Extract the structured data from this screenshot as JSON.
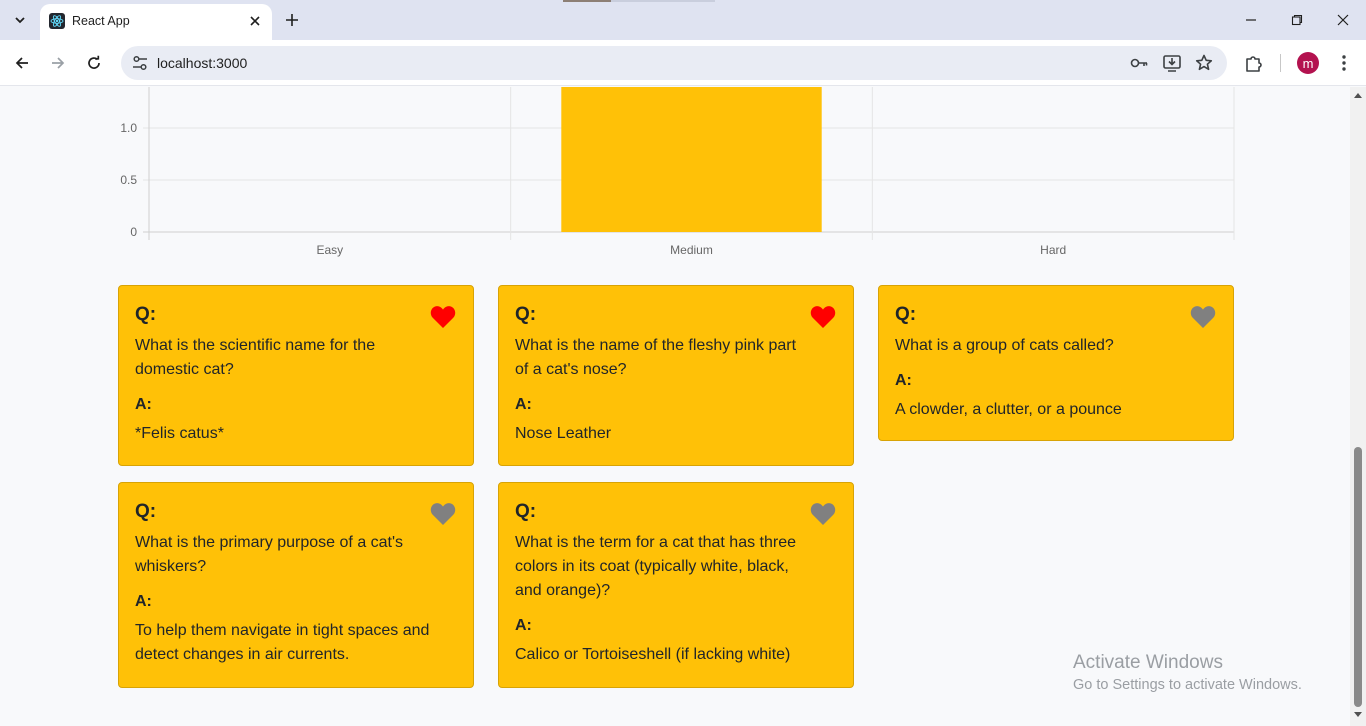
{
  "browser": {
    "tab": {
      "title": "React App"
    },
    "omnibox": {
      "url": "localhost:3000"
    },
    "profile_initial": "m"
  },
  "chart_data": {
    "type": "bar",
    "categories": [
      "Easy",
      "Medium",
      "Hard"
    ],
    "values": [
      0,
      2,
      0
    ],
    "yticks": [
      "0",
      "0.5",
      "1.0"
    ],
    "title": "",
    "xlabel": "",
    "ylabel": "",
    "ylim": [
      0,
      1.4
    ],
    "bar_color": "#ffc107",
    "grid": true
  },
  "cards": [
    {
      "q_label": "Q:",
      "question": "What is the scientific name for the domestic cat?",
      "a_label": "A:",
      "answer": "*Felis catus*",
      "favorite": true
    },
    {
      "q_label": "Q:",
      "question": "What is the name of the fleshy pink part of a cat's nose?",
      "a_label": "A:",
      "answer": "Nose Leather",
      "favorite": true
    },
    {
      "q_label": "Q:",
      "question": "What is a group of cats called?",
      "a_label": "A:",
      "answer": "A clowder, a clutter, or a pounce",
      "favorite": false
    },
    {
      "q_label": "Q:",
      "question": "What is the primary purpose of a cat's whiskers?",
      "a_label": "A:",
      "answer": "To help them navigate in tight spaces and detect changes in air currents.",
      "favorite": false
    },
    {
      "q_label": "Q:",
      "question": "What is the term for a cat that has three colors in its coat (typically white, black, and orange)?",
      "a_label": "A:",
      "answer": "Calico or Tortoiseshell (if lacking white)",
      "favorite": false
    }
  ],
  "colors": {
    "card_bg": "#ffc107",
    "heart_favorite": "#ff0000",
    "heart_default": "#808080"
  },
  "watermark": {
    "title": "Activate Windows",
    "subtitle": "Go to Settings to activate Windows."
  }
}
